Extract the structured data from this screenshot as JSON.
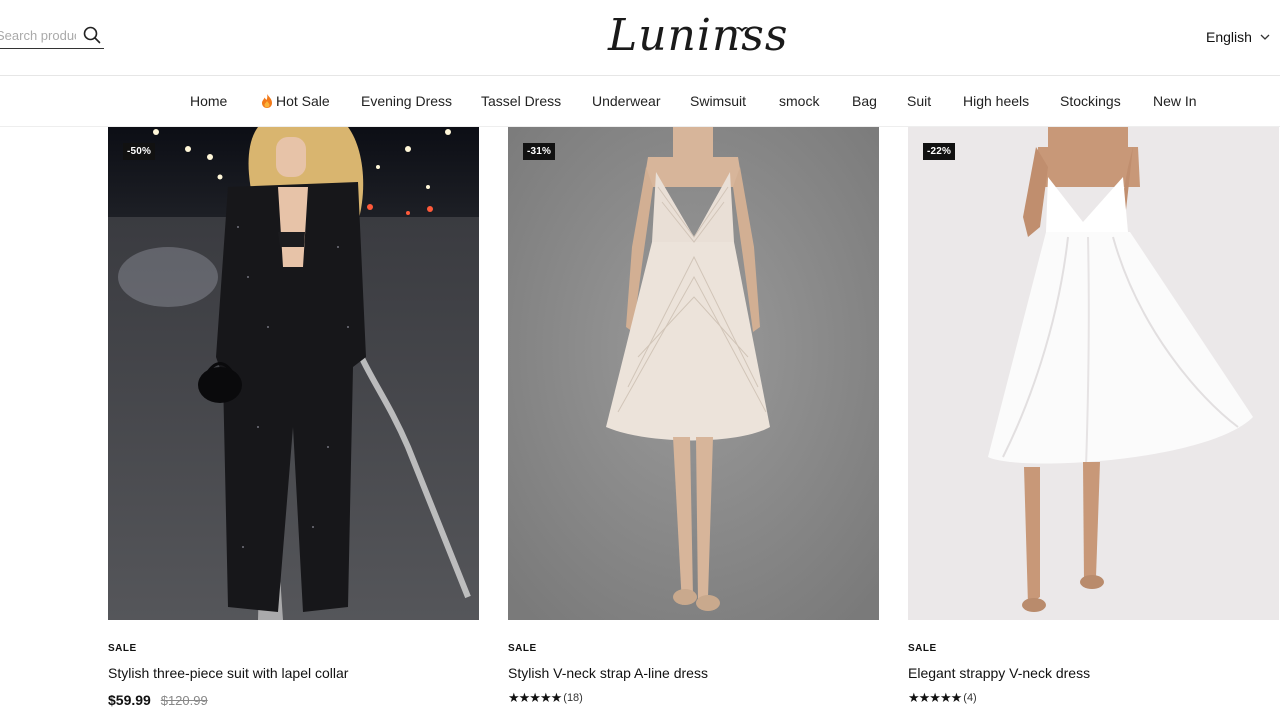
{
  "header": {
    "search_placeholder": "Search products",
    "search_visible_text": "ts",
    "logo_text": "Luninss",
    "language_label": "English"
  },
  "nav": {
    "items": [
      {
        "label": "Home"
      },
      {
        "label": "Hot Sale",
        "icon": "flame-icon"
      },
      {
        "label": "Evening Dress"
      },
      {
        "label": "Tassel Dress"
      },
      {
        "label": "Underwear"
      },
      {
        "label": "Swimsuit"
      },
      {
        "label": "smock"
      },
      {
        "label": "Bag"
      },
      {
        "label": "Suit"
      },
      {
        "label": "High heels"
      },
      {
        "label": "Stockings"
      },
      {
        "label": "New In"
      }
    ]
  },
  "products": [
    {
      "badge": "-50%",
      "tag": "SALE",
      "title": "Stylish three-piece suit with lapel collar",
      "price": "$59.99",
      "old_price": "$120.99"
    },
    {
      "badge": "-31%",
      "tag": "SALE",
      "title": "Stylish V-neck strap A-line dress",
      "stars": "★★★★★",
      "rating_count": "(18)"
    },
    {
      "badge": "-22%",
      "tag": "SALE",
      "title": "Elegant strappy V-neck dress",
      "stars": "★★★★★",
      "rating_count": "(4)"
    }
  ],
  "colors": {
    "badge_bg": "#111111",
    "card1_bg": "#1e1f24",
    "card2_bg": "#8a8a8a",
    "card3_bg": "#ebe8e9"
  }
}
